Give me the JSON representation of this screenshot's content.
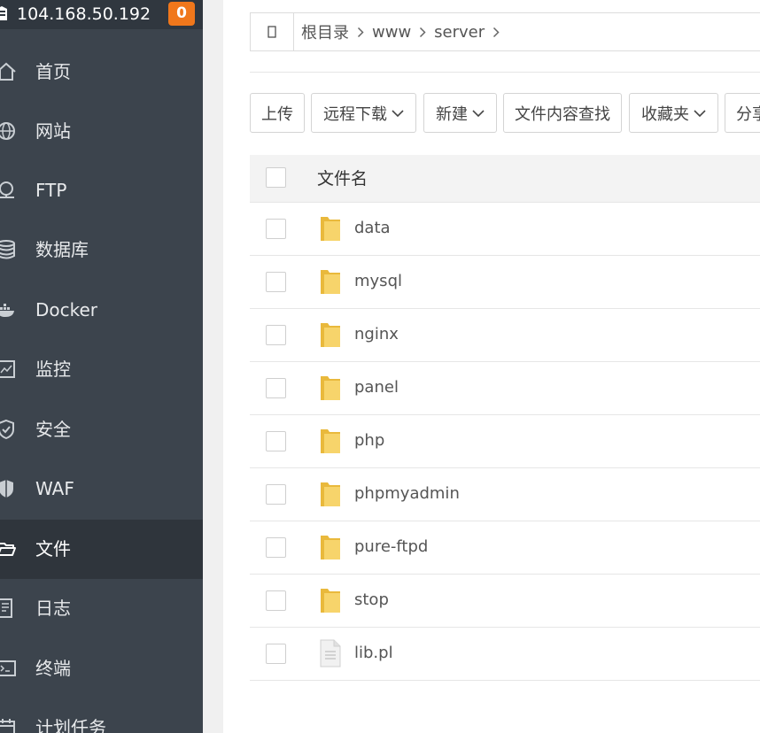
{
  "server": {
    "ip": "104.168.50.192",
    "badge": "0"
  },
  "sidebar": {
    "items": [
      {
        "label": "首页",
        "icon": "home-icon"
      },
      {
        "label": "网站",
        "icon": "globe-icon"
      },
      {
        "label": "FTP",
        "icon": "ftp-icon"
      },
      {
        "label": "数据库",
        "icon": "database-icon"
      },
      {
        "label": "Docker",
        "icon": "docker-icon"
      },
      {
        "label": "监控",
        "icon": "monitor-icon"
      },
      {
        "label": "安全",
        "icon": "shield-icon"
      },
      {
        "label": "WAF",
        "icon": "waf-shield-icon"
      },
      {
        "label": "文件",
        "icon": "folder-open-icon",
        "active": true
      },
      {
        "label": "日志",
        "icon": "log-icon"
      },
      {
        "label": "终端",
        "icon": "terminal-icon"
      },
      {
        "label": "计划任务",
        "icon": "calendar-icon"
      }
    ]
  },
  "breadcrumb": {
    "back_icon": "back-icon",
    "items": [
      "根目录",
      "www",
      "server"
    ]
  },
  "toolbar": {
    "buttons": [
      {
        "label": "上传"
      },
      {
        "label": "远程下载",
        "dropdown": true
      },
      {
        "label": "新建",
        "dropdown": true
      },
      {
        "label": "文件内容查找"
      },
      {
        "label": "收藏夹",
        "dropdown": true
      },
      {
        "label": "分享"
      }
    ]
  },
  "table": {
    "header": {
      "name": "文件名"
    },
    "rows": [
      {
        "name": "data",
        "type": "folder"
      },
      {
        "name": "mysql",
        "type": "folder"
      },
      {
        "name": "nginx",
        "type": "folder"
      },
      {
        "name": "panel",
        "type": "folder"
      },
      {
        "name": "php",
        "type": "folder"
      },
      {
        "name": "phpmyadmin",
        "type": "folder"
      },
      {
        "name": "pure-ftpd",
        "type": "folder"
      },
      {
        "name": "stop",
        "type": "folder"
      },
      {
        "name": "lib.pl",
        "type": "file"
      }
    ]
  },
  "colors": {
    "sidebar_bg": "#3c444d",
    "sidebar_active_bg": "#2f353c",
    "badge": "#f0771b",
    "folder": "#f5cc5a"
  }
}
